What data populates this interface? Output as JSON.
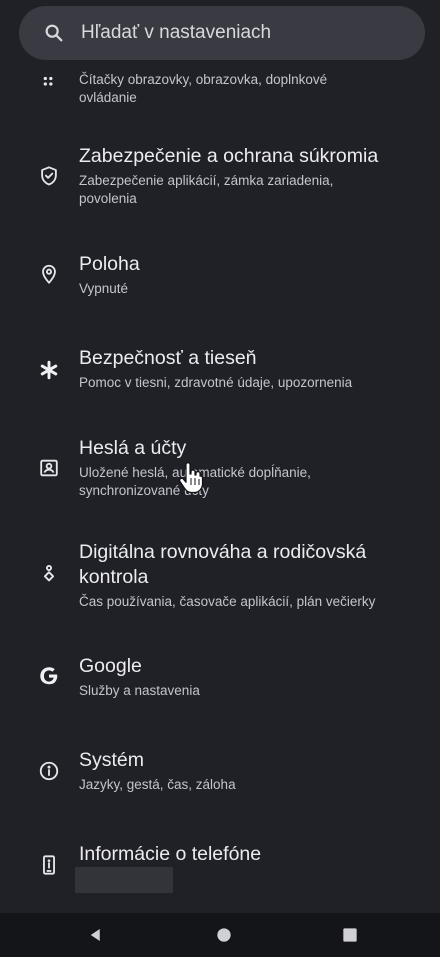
{
  "search": {
    "placeholder": "Hľadať v nastaveniach"
  },
  "settings": {
    "items": [
      {
        "icon": "accessibility-icon",
        "title": "",
        "subtitle_line1": "Čítačky obrazovky, obrazovka, doplnkové",
        "subtitle_line2": "ovládanie"
      },
      {
        "icon": "shield-check-icon",
        "title": "Zabezpečenie a ochrana súkromia",
        "subtitle_line1": "Zabezpečenie aplikácií, zámka zariadenia,",
        "subtitle_line2": "povolenia"
      },
      {
        "icon": "location-pin-icon",
        "title": "Poloha",
        "subtitle_line1": "Vypnuté",
        "subtitle_line2": ""
      },
      {
        "icon": "asterisk-icon",
        "title": "Bezpečnosť a tieseň",
        "subtitle_line1": "Pomoc v tiesni, zdravotné údaje, upozornenia",
        "subtitle_line2": ""
      },
      {
        "icon": "account-box-icon",
        "title": "Heslá a účty",
        "subtitle_line1": "Uložené heslá, automatické dopĺňanie,",
        "subtitle_line2": "synchronizované účty"
      },
      {
        "icon": "digital-wellbeing-icon",
        "title_line1": "Digitálna rovnováha a rodičovská",
        "title_line2": "kontrola",
        "subtitle_line1": "Čas používania, časovače aplikácií, plán večierky",
        "subtitle_line2": ""
      },
      {
        "icon": "google-g-icon",
        "title": "Google",
        "subtitle_line1": "Služby a nastavenia",
        "subtitle_line2": ""
      },
      {
        "icon": "info-circle-icon",
        "title": "Systém",
        "subtitle_line1": "Jazyky, gestá, čas, záloha",
        "subtitle_line2": ""
      },
      {
        "icon": "phone-info-icon",
        "title": "Informácie o telefóne",
        "subtitle_line1": "",
        "subtitle_line2": ""
      }
    ]
  },
  "colors": {
    "background": "#202127",
    "search_background": "#3a3b42",
    "text_primary": "#ececf0",
    "text_secondary": "#c4c5cc",
    "nav_background": "#141519"
  }
}
